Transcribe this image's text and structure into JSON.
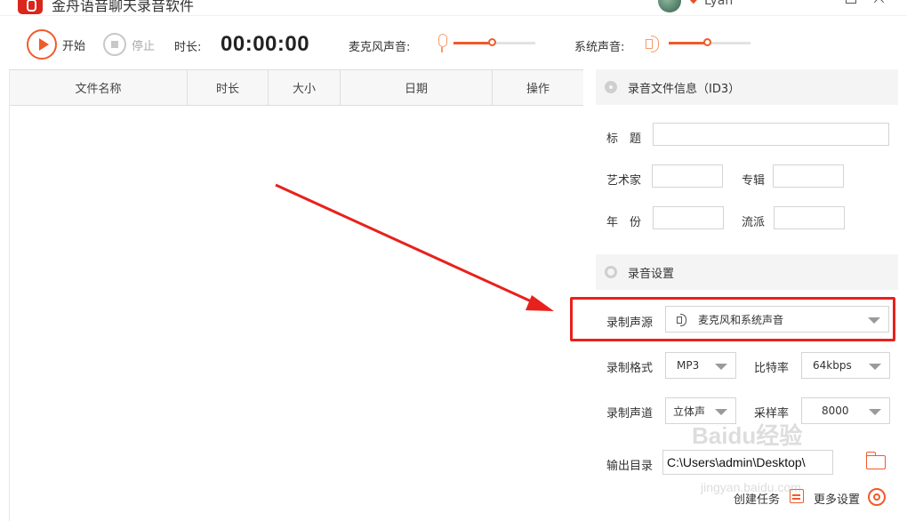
{
  "window": {
    "title": "金舟语音聊天录音软件",
    "user_name": "Lyan"
  },
  "toolbar": {
    "start_label": "开始",
    "stop_label": "停止",
    "duration_label": "时长:",
    "duration_value": "00:00:00",
    "mic_label": "麦克风声音:",
    "mic_volume": 0.48,
    "system_label": "系统声音:",
    "system_volume": 0.48
  },
  "file_table": {
    "columns": [
      "文件名称",
      "时长",
      "大小",
      "日期",
      "操作"
    ],
    "rows": []
  },
  "id3": {
    "section_title": "录音文件信息（ID3）",
    "title_label": "标　题",
    "title_value": "",
    "artist_label": "艺术家",
    "artist_value": "",
    "album_label": "专辑",
    "album_value": "",
    "year_label": "年　份",
    "year_value": "",
    "genre_label": "流派",
    "genre_value": ""
  },
  "settings": {
    "section_title": "录音设置",
    "source_label": "录制声源",
    "source_value": "麦克风和系统声音",
    "format_label": "录制格式",
    "format_value": "MP3",
    "bitrate_label": "比特率",
    "bitrate_value": "64kbps",
    "channel_label": "录制声道",
    "channel_value": "立体声",
    "samplerate_label": "采样率",
    "samplerate_value": "8000",
    "outdir_label": "输出目录",
    "outdir_value": "C:\\Users\\admin\\Desktop\\",
    "create_task_label": "创建任务",
    "more_settings_label": "更多设置"
  },
  "colors": {
    "accent": "#f15a2b",
    "highlight_box": "#e8211d",
    "annotation_arrow": "#e8211d"
  },
  "watermark": {
    "text": "Baidu经验",
    "sub": "jingyan.baidu.com"
  }
}
